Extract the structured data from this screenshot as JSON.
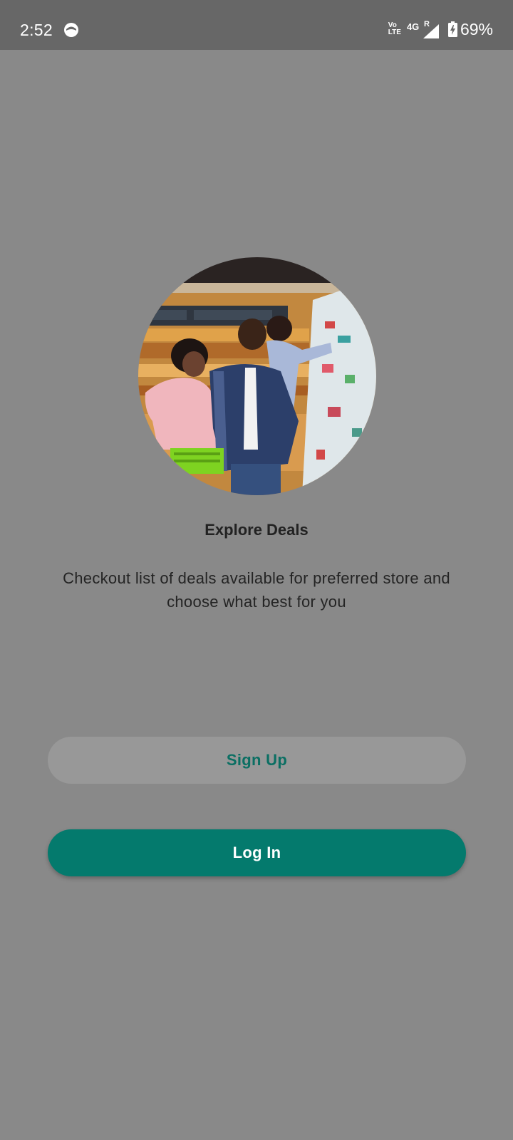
{
  "status_bar": {
    "time": "2:52",
    "volte_top": "Vo",
    "volte_bottom": "LTE",
    "network": "4G",
    "roaming": "R",
    "battery_percent": "69%"
  },
  "onboarding": {
    "image_icon": "family-shopping-photo",
    "title": "Explore Deals",
    "description": "Checkout list of deals available for preferred store and choose what best for you"
  },
  "actions": {
    "signup_label": "Sign Up",
    "login_label": "Log In"
  },
  "colors": {
    "background": "#898989",
    "status_bar": "#676767",
    "primary": "#047a6d",
    "signup_bg": "#989898",
    "signup_text": "#0b6f63"
  }
}
